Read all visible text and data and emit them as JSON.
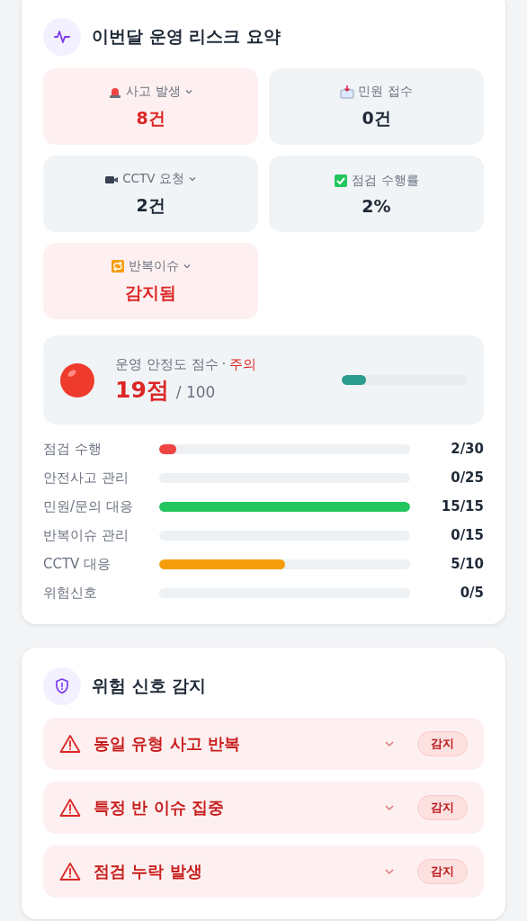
{
  "summary": {
    "title": "이번달 운영 리스크 요약",
    "tiles": [
      {
        "kind": "siren",
        "label": "사고 발생",
        "value": "8건",
        "alert": true,
        "expandable": true
      },
      {
        "kind": "mail",
        "label": "민원 접수",
        "value": "0건",
        "alert": false,
        "expandable": false
      },
      {
        "kind": "camera",
        "label": "CCTV 요청",
        "value": "2건",
        "alert": false,
        "expandable": true
      },
      {
        "kind": "check",
        "label": "점검 수행률",
        "value": "2%",
        "alert": false,
        "expandable": false
      },
      {
        "kind": "repeat",
        "label": "반복이슈",
        "value": "감지됨",
        "alert": true,
        "expandable": true
      }
    ],
    "score": {
      "label": "운영 안정도 점수",
      "separator": "·",
      "status": "주의",
      "value": "19점",
      "total": "/ 100",
      "level": 0.19
    },
    "metrics": [
      {
        "label": "점검 수행",
        "level": 0.067,
        "color": "#ef4444",
        "reading": "2/30"
      },
      {
        "label": "안전사고 관리",
        "reading": "0/25"
      },
      {
        "label": "민원/문의 대응",
        "level": 1,
        "color": "#22c55e",
        "reading": "15/15"
      },
      {
        "label": "반복이슈 관리",
        "reading": "0/15"
      },
      {
        "label": "CCTV 대응",
        "level": 0.5,
        "color": "#f59e0b",
        "reading": "5/10"
      },
      {
        "label": "위험신호",
        "reading": "0/5"
      }
    ]
  },
  "signals": {
    "title": "위험 신호 감지",
    "items": [
      {
        "label": "동일 유형 사고 반복",
        "badge": "감지"
      },
      {
        "label": "특정 반 이슈 집중",
        "badge": "감지"
      },
      {
        "label": "점검 누락 발생",
        "badge": "감지"
      }
    ]
  }
}
